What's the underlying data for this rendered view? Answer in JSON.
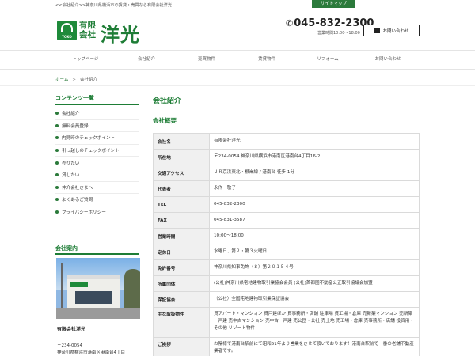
{
  "header": {
    "tagline": "<<会社紹介>>神奈川県横浜市の賃貸・売買なら有限会社洋光",
    "sitemap": "サイトマップ",
    "logo": {
      "corp": "有限会社",
      "name": "洋光",
      "badge": "YOKO"
    },
    "phone": "045-832-2300",
    "hours": "営業時間10:00～18:00",
    "contact_label": "お問い合わせ"
  },
  "nav": [
    "トップページ",
    "会社紹介",
    "売買物件",
    "賃貸物件",
    "リフォーム",
    "お問い合わせ"
  ],
  "breadcrumb": {
    "home": "ホーム",
    "sep": ">",
    "current": "会社紹介"
  },
  "sidebar": {
    "contents_title": "コンテンツ一覧",
    "items": [
      "会社紹介",
      "無料会員登録",
      "内見時のチェックポイント",
      "引っ越しのチェックポイント",
      "売りたい",
      "貸したい",
      "仲介会社さまへ",
      "よくあるご質問",
      "プライバシーポリシー"
    ],
    "office_title": "会社案内",
    "office_name": "有限会社洋光",
    "office_zip": "〒234-0054",
    "office_address": "神奈川県横浜市港南区港南台4丁目"
  },
  "main": {
    "title": "会社紹介",
    "section_title": "会社概要",
    "rows": [
      {
        "label": "会社名",
        "value": "有限会社洋光"
      },
      {
        "label": "所在地",
        "value": "〒234-0054 神奈川県横浜市港南区港南台4丁目16-2"
      },
      {
        "label": "交通アクセス",
        "value": "ＪＲ京浜東北・根岸線 / 港南台 徒歩 1分"
      },
      {
        "label": "代表者",
        "value": "永作　敬子"
      },
      {
        "label": "TEL",
        "value": "045-832-2300"
      },
      {
        "label": "FAX",
        "value": "045-831-3587"
      },
      {
        "label": "営業時間",
        "value": "10:00～18:00"
      },
      {
        "label": "定休日",
        "value": "水曜日、第２・第３火曜日"
      },
      {
        "label": "免許番号",
        "value": "神奈川県知事免許（８）第２０１５４号"
      },
      {
        "label": "所属団体",
        "value": "(公社)神奈川県宅地建物取引業協会会員 (公社)首都圏不動産公正取引協議会加盟"
      },
      {
        "label": "保証協会",
        "value": "（公社）全国宅地建物取引業保証協会"
      },
      {
        "label": "主な取扱物件",
        "value": "貸アパート・マンション 貸戸建ほか 貸事務所・店舗 駐車場 貸工場・倉庫 売新築マンション 売新築一戸建 売中古マンション 売中古一戸建 売公団・公社 売土地 売工場・倉庫 売事務所・店舗 投資用・その他 リゾート物件"
      },
      {
        "label": "ご挨拶",
        "value": "お陰様で港南台駅前にて昭和51年より営業をさせて頂いております！港南台駅前で一番の老舗不動産業者です。"
      }
    ]
  }
}
